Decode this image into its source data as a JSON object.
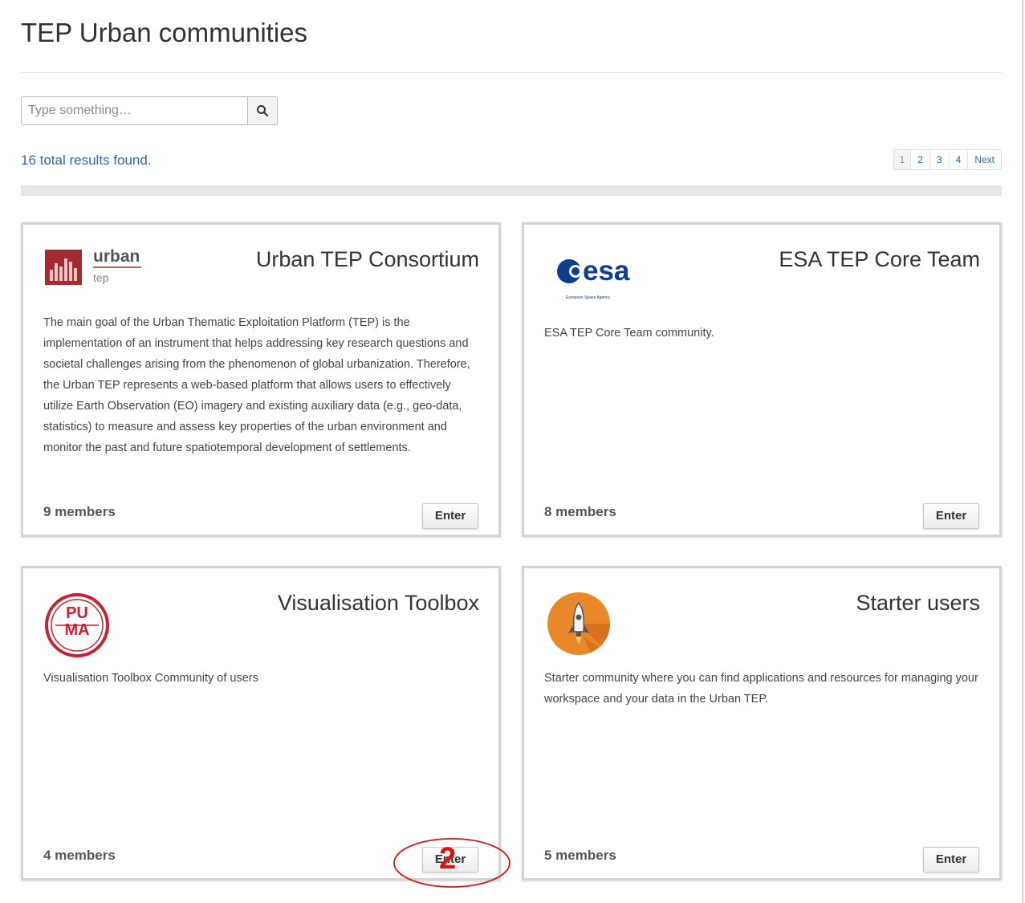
{
  "page": {
    "title": "TEP Urban communities"
  },
  "search": {
    "placeholder": "Type something…"
  },
  "results": {
    "text": "16 total results found."
  },
  "pagination": {
    "pages": [
      "1",
      "2",
      "3",
      "4"
    ],
    "next": "Next",
    "current": "1"
  },
  "cards": [
    {
      "title": "Urban TEP Consortium",
      "logo_text": "urban",
      "logo_subtext": "tep",
      "description": "The main goal of the Urban Thematic Exploitation Platform (TEP) is the implementation of an instrument that helps addressing key research questions and societal challenges arising from the phenomenon of global urbanization. Therefore, the Urban TEP represents a web-based platform that allows users to effectively utilize Earth Observation (EO) imagery and existing auxiliary data (e.g., geo-data, statistics) to measure and assess key properties of the urban environment and monitor the past and future spatiotemporal development of settlements.",
      "members": "9 members",
      "enter": "Enter"
    },
    {
      "title": "ESA TEP Core Team",
      "logo_text": "esa",
      "logo_subtext": "European Space Agency",
      "description": "ESA TEP Core Team community.",
      "members": "8 members",
      "enter": "Enter"
    },
    {
      "title": "Visualisation Toolbox",
      "logo_text": "PU MA",
      "description": "Visualisation Toolbox Community of users",
      "members": "4 members",
      "enter": "Enter"
    },
    {
      "title": "Starter users",
      "description": "Starter community where you can find applications and resources for managing your workspace and your data in the Urban TEP.",
      "members": "5 members",
      "enter": "Enter"
    }
  ],
  "annotation": {
    "label": "2",
    "color": "#e01010"
  },
  "colors": {
    "link": "#2a6aa6",
    "border": "#d4d4d4",
    "urban_red": "#a32a2e",
    "esa_blue": "#0b3d91",
    "puma_red": "#c8202f",
    "starter_orange": "#e8882a"
  }
}
